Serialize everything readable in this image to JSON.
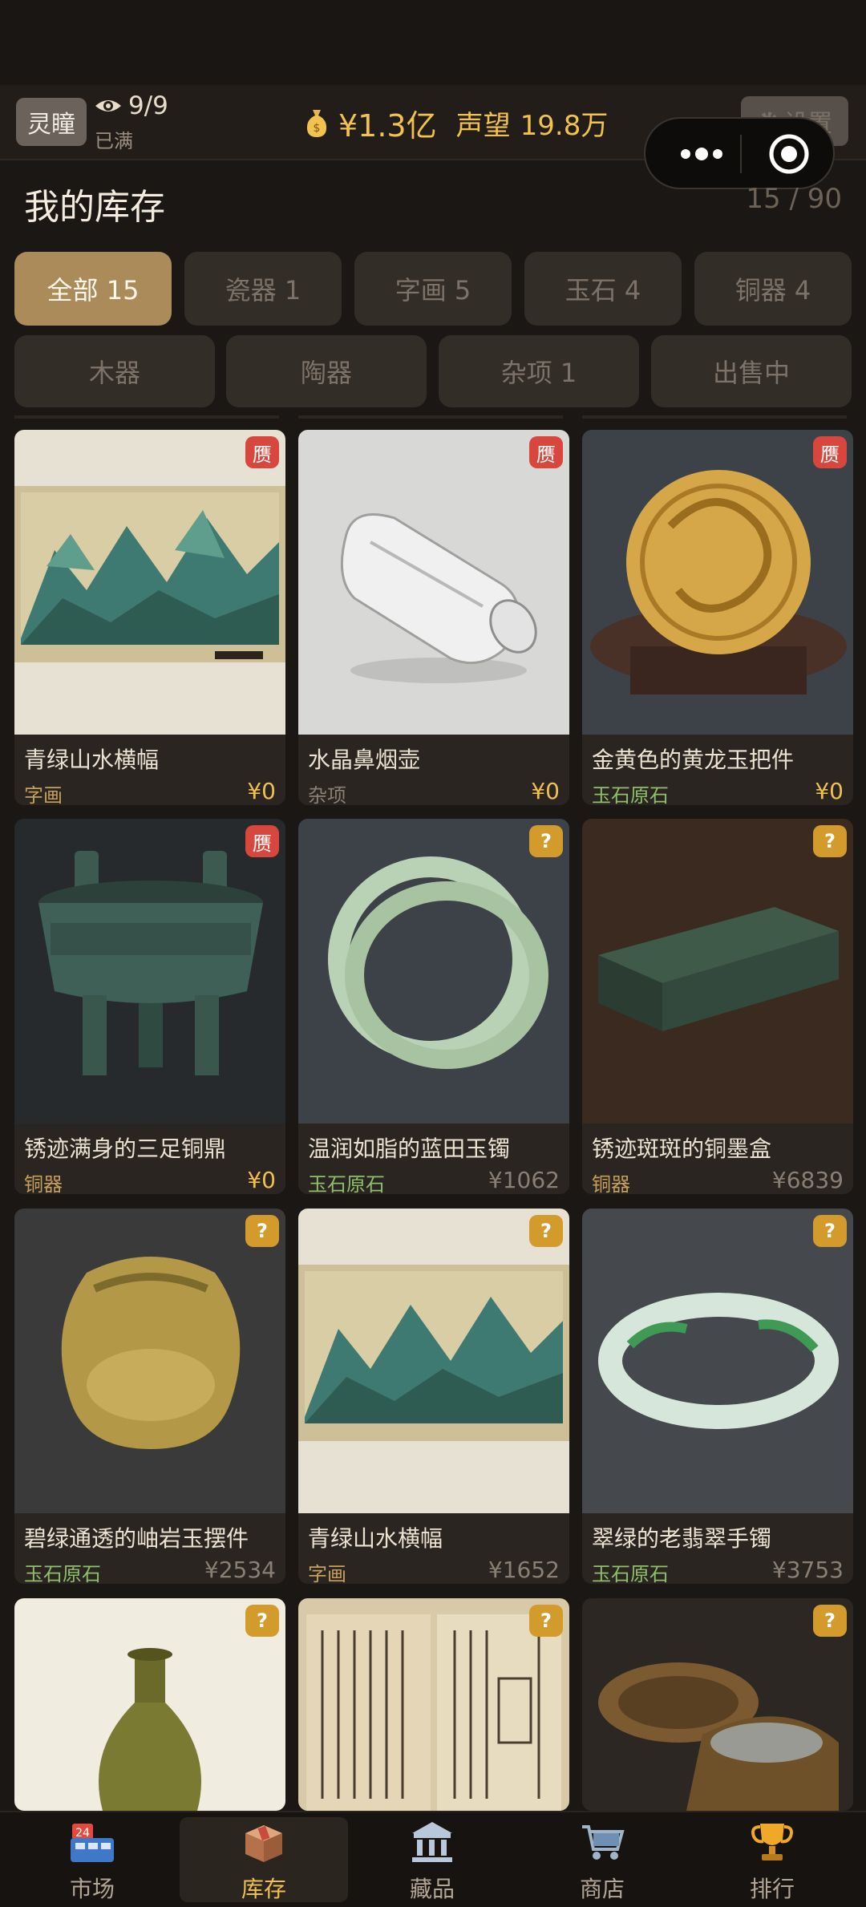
{
  "header": {
    "role_badge": "灵瞳",
    "eye_count": "9/9",
    "eye_status": "已满",
    "money": "¥1.3亿",
    "fame_label": "声望",
    "fame_value": "19.8万",
    "settings_label": "设置"
  },
  "page": {
    "title": "我的库存",
    "capacity": "15 / 90"
  },
  "tabs": [
    {
      "label": "全部 15",
      "active": true
    },
    {
      "label": "瓷器 1"
    },
    {
      "label": "字画 5"
    },
    {
      "label": "玉石 4"
    },
    {
      "label": "铜器 4"
    }
  ],
  "filters": [
    {
      "label": "木器"
    },
    {
      "label": "陶器"
    },
    {
      "label": "杂项 1"
    },
    {
      "label": "出售中"
    }
  ],
  "items": [
    {
      "name": "青绿山水横幅",
      "category": "字画",
      "price": "¥0",
      "tag": "赝"
    },
    {
      "name": "水晶鼻烟壶",
      "category": "杂项",
      "price": "¥0",
      "tag": "赝"
    },
    {
      "name": "金黄色的黄龙玉把件",
      "category": "玉石原石",
      "price": "¥0",
      "tag": "赝"
    },
    {
      "name": "锈迹满身的三足铜鼎",
      "category": "铜器",
      "price": "¥0",
      "tag": "赝"
    },
    {
      "name": "温润如脂的蓝田玉镯",
      "category": "玉石原石",
      "price": "¥1062",
      "tag": "?"
    },
    {
      "name": "锈迹斑斑的铜墨盒",
      "category": "铜器",
      "price": "¥6839",
      "tag": "?"
    },
    {
      "name": "碧绿通透的岫岩玉摆件",
      "category": "玉石原石",
      "price": "¥2534",
      "tag": "?"
    },
    {
      "name": "青绿山水横幅",
      "category": "字画",
      "price": "¥1652",
      "tag": "?"
    },
    {
      "name": "翠绿的老翡翠手镯",
      "category": "玉石原石",
      "price": "¥3753",
      "tag": "?"
    },
    {
      "tag": "?"
    },
    {
      "tag": "?"
    },
    {
      "tag": "?"
    }
  ],
  "nav": [
    {
      "label": "市场",
      "icon": "market-calendar-icon",
      "badge": "24"
    },
    {
      "label": "库存",
      "icon": "inventory-box-icon",
      "active": true
    },
    {
      "label": "藏品",
      "icon": "museum-icon"
    },
    {
      "label": "商店",
      "icon": "shopping-cart-icon"
    },
    {
      "label": "排行",
      "icon": "trophy-icon"
    }
  ],
  "colors": {
    "accent_gold": "#f0c04d",
    "active_tab": "#ab8b5a",
    "fake_tag": "#d8473d",
    "unknown_tag": "#d39a2c",
    "jade_green": "#8ebf6b"
  }
}
